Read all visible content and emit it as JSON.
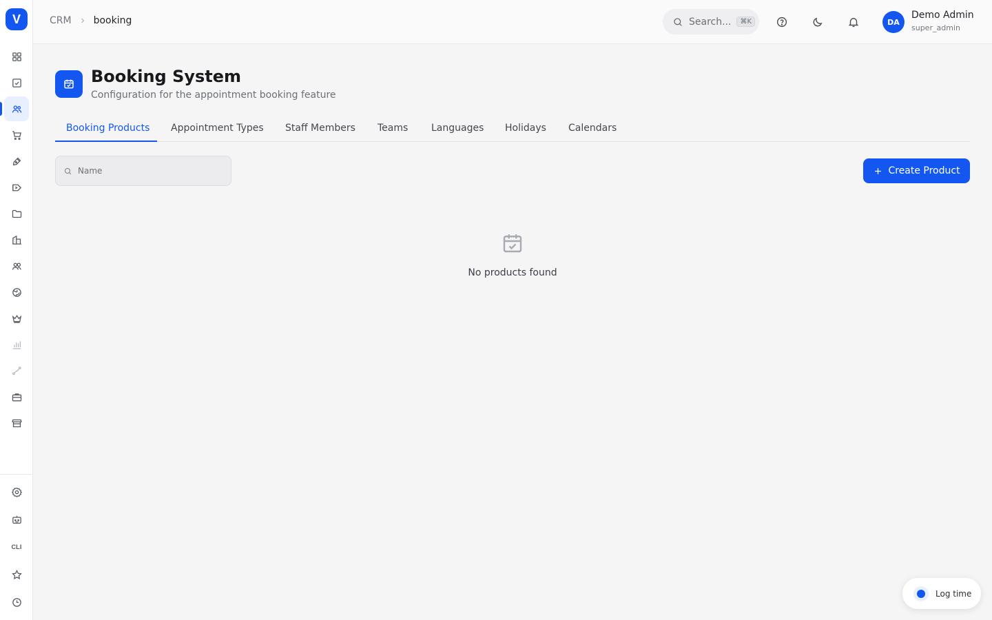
{
  "app": {
    "logo_letter": "V"
  },
  "breadcrumb": {
    "root": "CRM",
    "current": "booking"
  },
  "header": {
    "search_label": "Search...",
    "search_shortcut": "⌘K",
    "user": {
      "initials": "DA",
      "name": "Demo Admin",
      "role": "super_admin"
    }
  },
  "page": {
    "title": "Booking System",
    "subtitle": "Configuration for the appointment booking feature"
  },
  "tabs": [
    {
      "label": "Booking Products",
      "active": true
    },
    {
      "label": "Appointment Types",
      "active": false
    },
    {
      "label": "Staff Members",
      "active": false
    },
    {
      "label": "Teams",
      "active": false
    },
    {
      "label": "Languages",
      "active": false
    },
    {
      "label": "Holidays",
      "active": false
    },
    {
      "label": "Calendars",
      "active": false
    }
  ],
  "filter": {
    "placeholder": "Name"
  },
  "actions": {
    "create_label": "Create Product"
  },
  "empty_state": {
    "message": "No products found"
  },
  "sidebar": {
    "icons": [
      "dashboard-icon",
      "tasks-icon",
      "users-icon",
      "cart-icon",
      "pen-icon",
      "campaign-icon",
      "folder-icon",
      "building-icon",
      "contacts-icon",
      "globe-icon",
      "crown-icon",
      "bar-chart-icon",
      "route-icon",
      "briefcase-icon",
      "store-icon"
    ],
    "bottom_icons": [
      "settings-icon",
      "robot-icon",
      "cli-icon",
      "star-icon",
      "clock-icon"
    ],
    "cli_label": "CLI"
  },
  "log_time": {
    "label": "Log time"
  },
  "colors": {
    "primary": "#1357f0",
    "background": "#f5f5f6"
  }
}
